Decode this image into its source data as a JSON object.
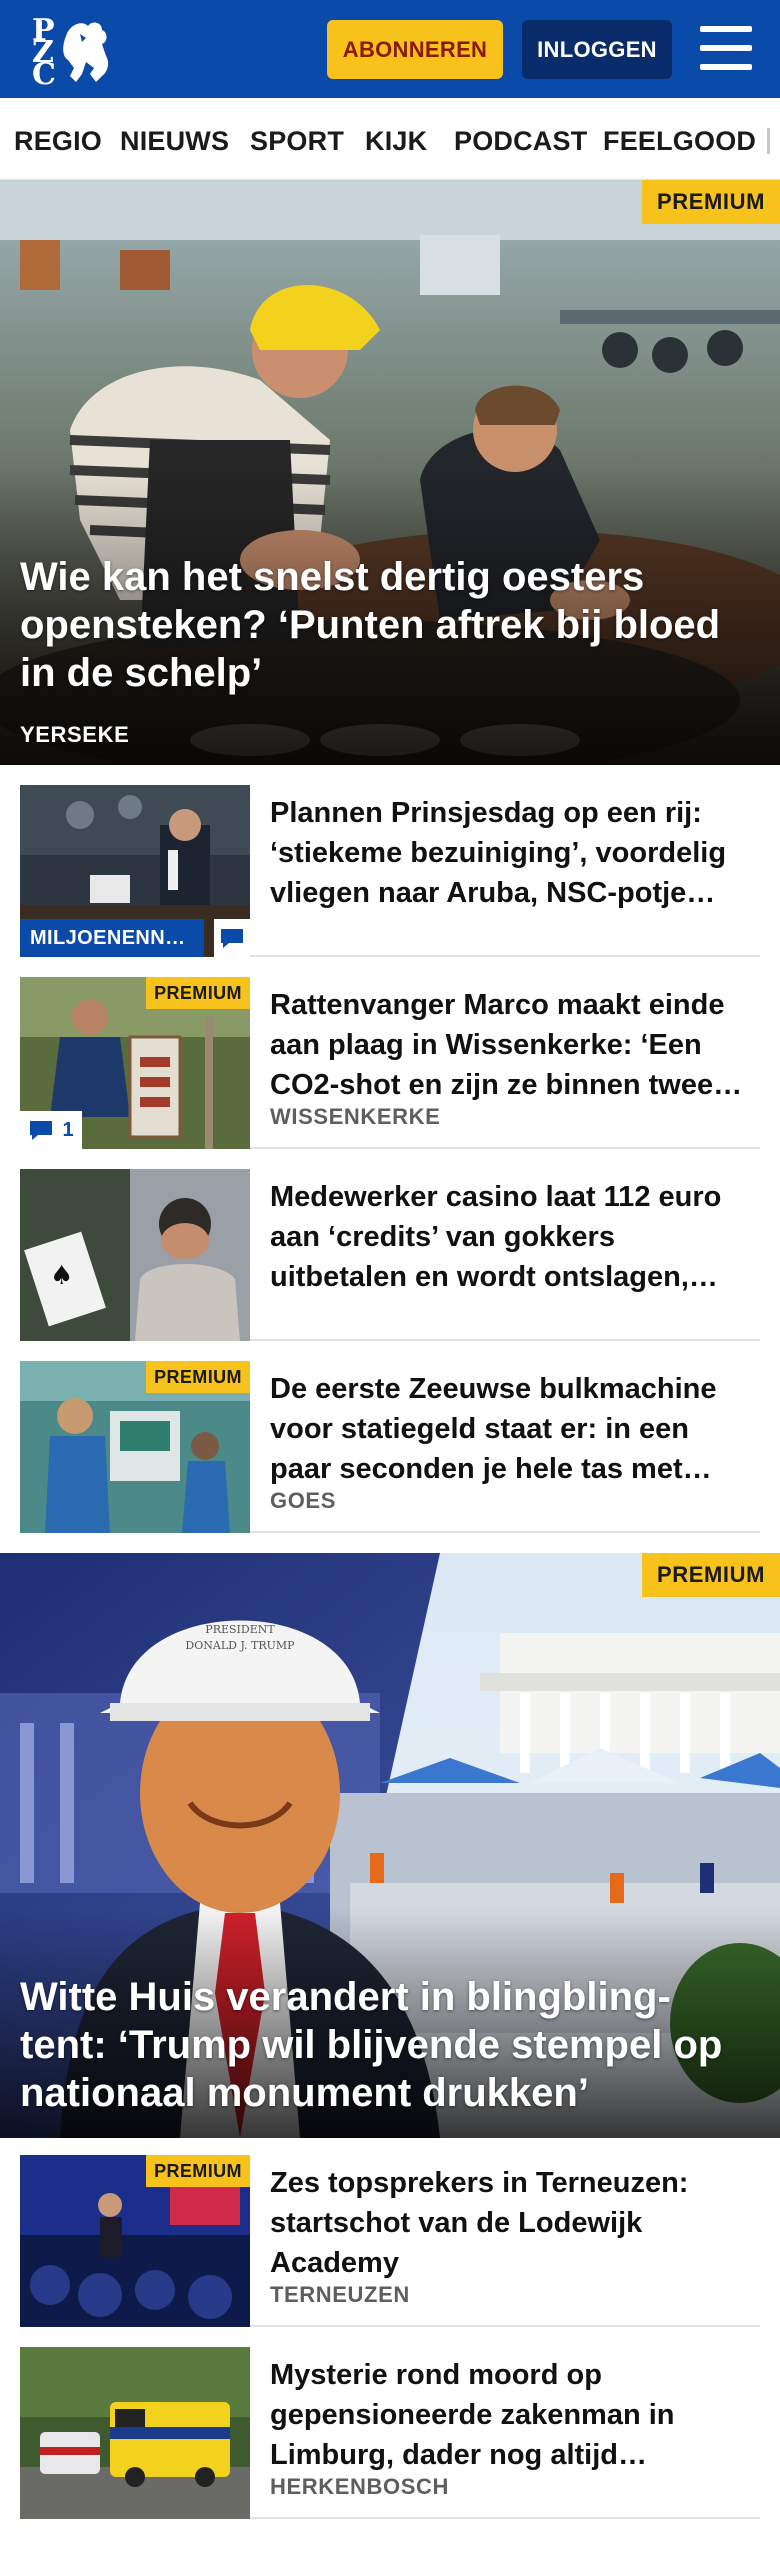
{
  "header": {
    "subscribe_label": "ABONNEREN",
    "login_label": "INLOGGEN",
    "logo_letters": [
      "P",
      "Z",
      "C"
    ]
  },
  "nav": {
    "items": [
      "REGIO",
      "NIEUWS",
      "SPORT",
      "KIJK",
      "PODCAST",
      "FEELGOOD"
    ]
  },
  "hero": {
    "badge": "PREMIUM",
    "title_lines": [
      "Wie kan het snelst dertig oesters",
      "opensteken? ‘Punten aftrek bij bloed",
      "in de schelp’"
    ],
    "location": "YERSEKE"
  },
  "articles": [
    {
      "title_lines": [
        "Plannen Prinsjesdag op een rij:",
        "‘stiekeme bezuiniging’, voordelig",
        "vliegen naar Aruba, NSC-potje…"
      ],
      "location": "",
      "tag": "MILJOENENN…",
      "premium": ""
    },
    {
      "title_lines": [
        "Rattenvanger Marco maakt einde",
        "aan plaag in Wissenkerke: ‘Een",
        "CO2-shot en zijn ze binnen twee…"
      ],
      "location": "WISSENKERKE",
      "premium": "PREMIUM",
      "comments": "1"
    },
    {
      "title_lines": [
        "Medewerker casino laat 112 euro",
        "aan ‘credits’ van gokkers",
        "uitbetalen en wordt ontslagen,…"
      ],
      "location": "",
      "premium": ""
    },
    {
      "title_lines": [
        "De eerste Zeeuwse bulkmachine",
        "voor statiegeld staat er: in een",
        "paar seconden je hele tas met…"
      ],
      "location": "GOES",
      "premium": "PREMIUM"
    }
  ],
  "hero2": {
    "badge": "PREMIUM",
    "helmet_text": [
      "PRESIDENT",
      "DONALD J. TRUMP"
    ],
    "title_lines": [
      "Witte Huis verandert in blingbling-",
      "tent: ‘Trump wil blijvende stempel op",
      "nationaal monument drukken’"
    ]
  },
  "articles2": [
    {
      "title_lines": [
        "Zes topsprekers in Terneuzen:",
        "startschot van de Lodewijk",
        "Academy"
      ],
      "location": "TERNEUZEN",
      "premium": "PREMIUM"
    },
    {
      "title_lines": [
        "Mysterie rond moord op",
        "gepensioneerde zakenman in",
        "Limburg, dader nog altijd…"
      ],
      "location": "HERKENBOSCH",
      "premium": ""
    }
  ],
  "colors": {
    "brand_blue": "#0a4aa8",
    "premium_yellow": "#f7c21b",
    "subscribe_text": "#8b1a00",
    "login_bg": "#0b2c6b"
  }
}
